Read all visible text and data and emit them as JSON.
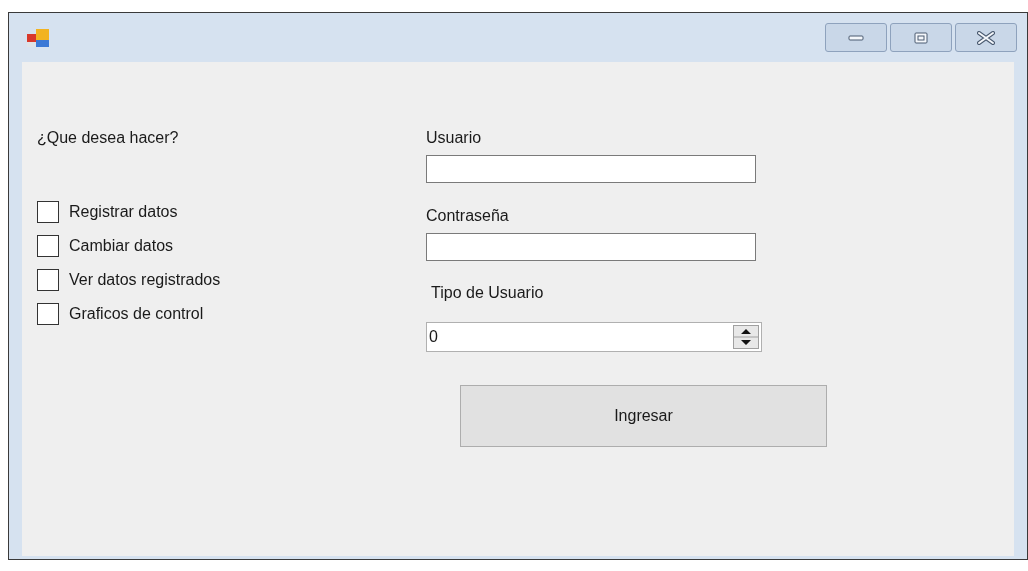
{
  "window": {
    "buttons": [
      {
        "kind": "minimize"
      },
      {
        "kind": "maximize"
      },
      {
        "kind": "close"
      }
    ]
  },
  "prompt": "¿Que desea hacer?",
  "options": [
    {
      "label": "Registrar datos",
      "checked": false
    },
    {
      "label": "Cambiar datos",
      "checked": false
    },
    {
      "label": "Ver datos registrados",
      "checked": false
    },
    {
      "label": "Graficos de control",
      "checked": false
    }
  ],
  "user_label": "Usuario",
  "password_label": "Contraseña",
  "type_label": "Tipo de Usuario",
  "type_value": "0",
  "submit": "Ingresar"
}
